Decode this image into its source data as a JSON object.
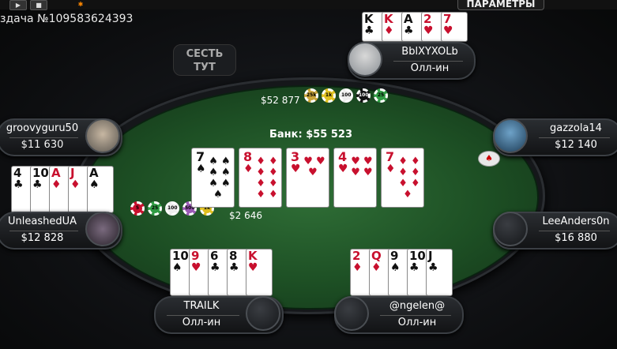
{
  "top_bar": {
    "params_label": "ПАРАМЕТРЫ",
    "play_icon": "▶",
    "stop_icon": "■",
    "gear_icon": "✱"
  },
  "hand_id": "здача №109583624393",
  "sit_here": {
    "line1": "СЕСТЬ",
    "line2": "ТУТ"
  },
  "pot": {
    "label": "Банк: $55 523"
  },
  "bets": {
    "top": "$52 877",
    "left": "$2 646"
  },
  "board": [
    {
      "rank": "7",
      "suit": "♠",
      "color": "blk"
    },
    {
      "rank": "8",
      "suit": "♦",
      "color": "red"
    },
    {
      "rank": "3",
      "suit": "♥",
      "color": "red"
    },
    {
      "rank": "4",
      "suit": "♥",
      "color": "red"
    },
    {
      "rank": "7",
      "suit": "♦",
      "color": "red"
    }
  ],
  "players": {
    "top": {
      "name": "BblXYXOLb",
      "status": "Олл-ин",
      "cards": [
        {
          "rank": "K",
          "suit": "♣",
          "color": "blk"
        },
        {
          "rank": "K",
          "suit": "♦",
          "color": "red"
        },
        {
          "rank": "A",
          "suit": "♣",
          "color": "blk"
        },
        {
          "rank": "2",
          "suit": "♥",
          "color": "red"
        },
        {
          "rank": "7",
          "suit": "♥",
          "color": "red"
        }
      ]
    },
    "left1": {
      "name": "groovyguru50",
      "stack": "$11 630"
    },
    "left2": {
      "name": "UnleashedUA",
      "stack": "$12 828",
      "cards": [
        {
          "rank": "4",
          "suit": "♣",
          "color": "blk"
        },
        {
          "rank": "10",
          "suit": "♣",
          "color": "blk"
        },
        {
          "rank": "A",
          "suit": "♦",
          "color": "red"
        },
        {
          "rank": "J",
          "suit": "♦",
          "color": "red"
        },
        {
          "rank": "A",
          "suit": "♠",
          "color": "blk"
        }
      ]
    },
    "right1": {
      "name": "gazzola14",
      "stack": "$12 140"
    },
    "right2": {
      "name": "LeeAnders0n",
      "stack": "$16 880"
    },
    "bottom_left": {
      "name": "TRAILK",
      "status": "Олл-ин",
      "cards": [
        {
          "rank": "10",
          "suit": "♠",
          "color": "blk"
        },
        {
          "rank": "9",
          "suit": "♥",
          "color": "red"
        },
        {
          "rank": "6",
          "suit": "♣",
          "color": "blk"
        },
        {
          "rank": "8",
          "suit": "♣",
          "color": "blk"
        },
        {
          "rank": "K",
          "suit": "♥",
          "color": "red"
        }
      ]
    },
    "bottom_right": {
      "name": "@ngelen@",
      "status": "Олл-ин",
      "cards": [
        {
          "rank": "2",
          "suit": "♦",
          "color": "red"
        },
        {
          "rank": "Q",
          "suit": "♦",
          "color": "red"
        },
        {
          "rank": "9",
          "suit": "♠",
          "color": "blk"
        },
        {
          "rank": "10",
          "suit": "♣",
          "color": "blk"
        },
        {
          "rank": "J",
          "suit": "♣",
          "color": "blk"
        }
      ]
    }
  },
  "chips_top": [
    "25k",
    "1k",
    "100",
    "100",
    "25"
  ],
  "chips_left": [
    "5",
    "25",
    "100",
    "500",
    "1k"
  ],
  "dealer_button": "♠",
  "colors": {
    "felt": "#2f6e36",
    "accent_red": "#c8102e"
  }
}
